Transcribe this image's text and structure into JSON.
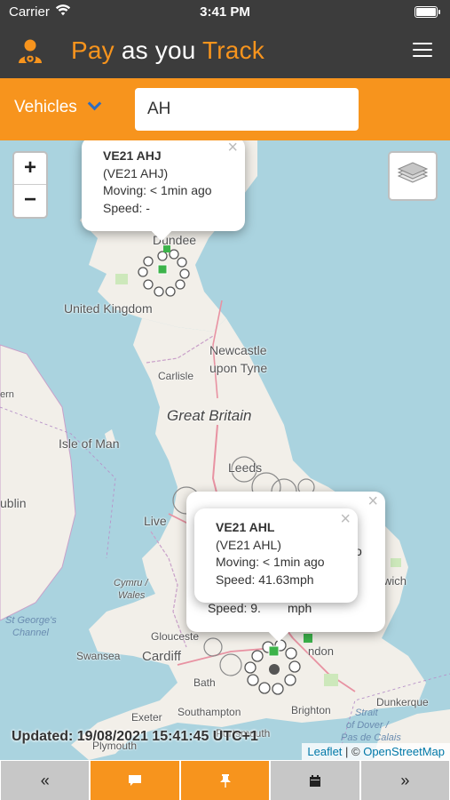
{
  "status_bar": {
    "carrier": "Carrier",
    "time": "3:41 PM"
  },
  "header": {
    "title_part1": "Pay",
    "title_part2": " as you ",
    "title_part3": "Track"
  },
  "search": {
    "selector_label": "Vehicles",
    "query": "AH"
  },
  "map": {
    "labels": {
      "dundee": "Dundee",
      "uk": "United Kingdom",
      "newcastle": "Newcastle",
      "upon_tyne": "upon Tyne",
      "carlisle": "Carlisle",
      "great_britain": "Great Britain",
      "isle_of_man": "Isle of Man",
      "dublin": "ublin",
      "leeds": "Leeds",
      "liverpool": "Live",
      "cymru": "Cymru /",
      "wales": "Wales",
      "swansea": "Swansea",
      "cardiff": "Cardiff",
      "gloucester": "Glouceste",
      "bath": "Bath",
      "exeter": "Exeter",
      "southampton": "Southampton",
      "brighton": "Brighton",
      "portsmouth": "Portsmouth",
      "plymouth": "Plymouth",
      "dunkerque": "Dunkerque",
      "london": "ndon",
      "norwich": "wich",
      "stgeorges1": "St George's",
      "stgeorges2": "Channel",
      "strait": "Strait",
      "of_dover": "of Dover /",
      "calais": "Pas de Calais",
      "ern": "ern"
    },
    "popups": [
      {
        "plate": "VE21 AHJ",
        "sub": "(VE21 AHJ)",
        "status": "Moving: < 1min ago",
        "speed": "Speed: -"
      },
      {
        "plate": "VE21 AHL",
        "sub": "(VE21 AHL)",
        "status": "Moving: < 1min ago",
        "speed": "Speed: 41.63mph"
      }
    ],
    "hidden_popup": {
      "speed_peek": "Speed: 9.",
      "speed_peek_end": "mph",
      "peek_char": "o"
    },
    "attribution": {
      "leaflet": "Leaflet",
      "separator": " | © ",
      "osm": "OpenStreetMap"
    },
    "marker_color": "#3cb34a"
  },
  "updated_text": "Updated: 19/08/2021 15:41:45 UTC+1",
  "toolbar": [
    {
      "icon": "double-left-icon",
      "glyph": "«"
    },
    {
      "icon": "comment-icon",
      "glyph": "💬"
    },
    {
      "icon": "pin-icon",
      "glyph": "📌"
    },
    {
      "icon": "calendar-icon",
      "glyph": "📅"
    },
    {
      "icon": "double-right-icon",
      "glyph": "»"
    }
  ],
  "colors": {
    "accent": "#f7941d",
    "header": "#3c3c3c",
    "chevron": "#2e6dbf"
  }
}
